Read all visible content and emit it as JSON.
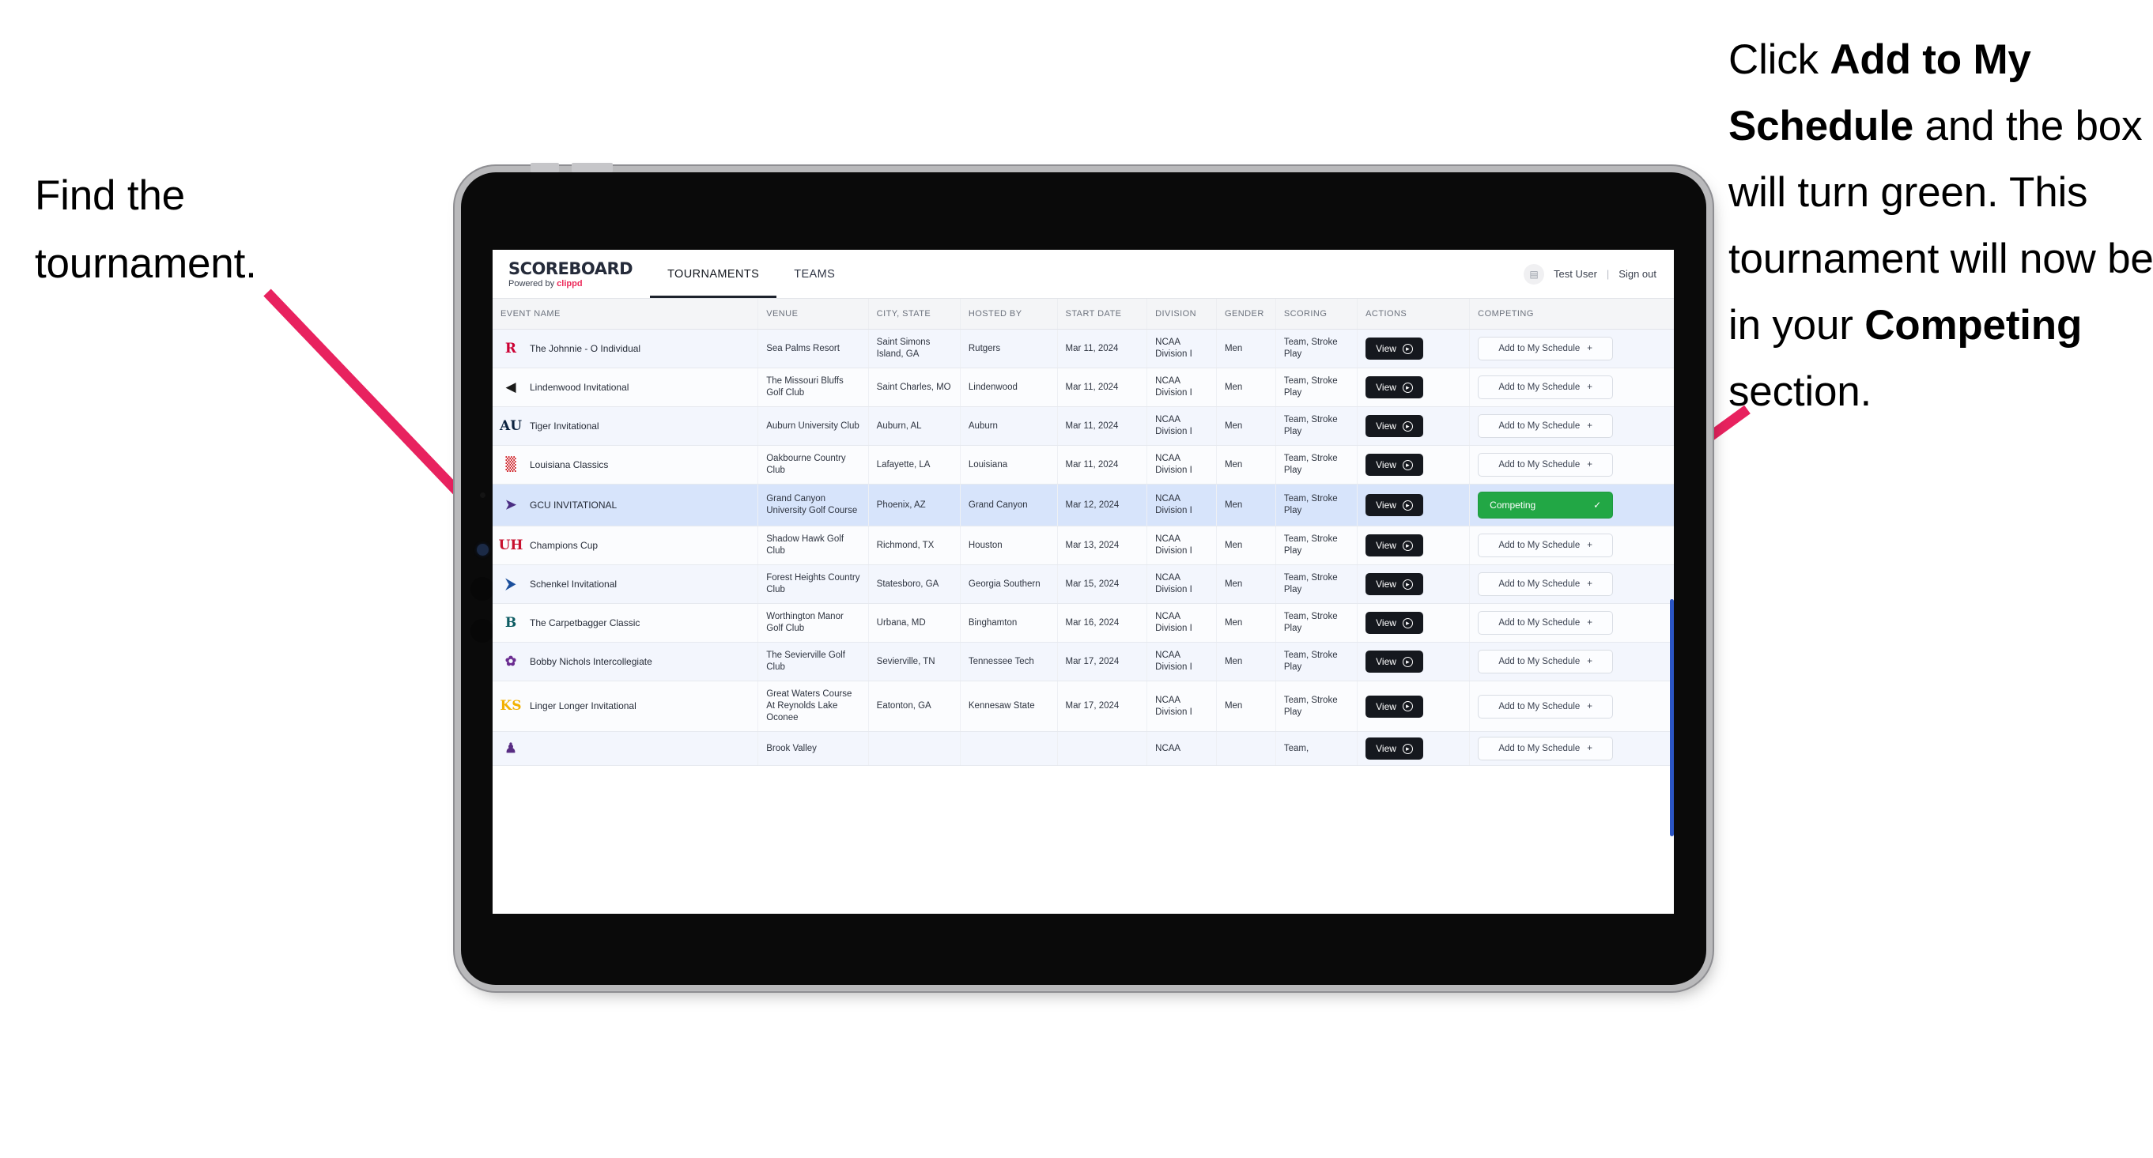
{
  "annotations": {
    "left": "Find the tournament.",
    "right_parts": [
      {
        "text": "Click ",
        "bold": false
      },
      {
        "text": "Add to My Schedule",
        "bold": true
      },
      {
        "text": " and the box will turn green. This tournament will now be in your ",
        "bold": false
      },
      {
        "text": "Competing",
        "bold": true
      },
      {
        "text": " section.",
        "bold": false
      }
    ],
    "arrow_color": "#e8225f"
  },
  "app": {
    "brand": {
      "title": "SCOREBOARD",
      "powered_prefix": "Powered by ",
      "powered_brand": "clippd",
      "brand_accent": "#ec2a5a"
    },
    "nav": [
      {
        "label": "TOURNAMENTS",
        "active": true
      },
      {
        "label": "TEAMS",
        "active": false
      }
    ],
    "account": {
      "avatar_icon": "user-avatar-icon",
      "user": "Test User",
      "separator": "|",
      "sign_out": "Sign out"
    },
    "table": {
      "columns": [
        "EVENT NAME",
        "VENUE",
        "CITY, STATE",
        "HOSTED BY",
        "START DATE",
        "DIVISION",
        "GENDER",
        "SCORING",
        "ACTIONS",
        "COMPETING"
      ],
      "action_label": "View",
      "add_label": "Add to My Schedule",
      "add_plus": "+",
      "competing_label": "Competing",
      "competing_check": "✓",
      "competing_color": "#22a745",
      "rows": [
        {
          "logo": {
            "text": "R",
            "color": "#cc0033",
            "bg": "transparent"
          },
          "event": "The Johnnie - O Individual",
          "venue": "Sea Palms Resort",
          "city": "Saint Simons Island, GA",
          "hosted_by": "Rutgers",
          "start_date": "Mar 11, 2024",
          "division": "NCAA Division I",
          "gender": "Men",
          "scoring": "Team, Stroke Play",
          "competing": false
        },
        {
          "logo": {
            "text": "◀",
            "color": "#1a1a1a",
            "bg": "transparent"
          },
          "event": "Lindenwood Invitational",
          "venue": "The Missouri Bluffs Golf Club",
          "city": "Saint Charles, MO",
          "hosted_by": "Lindenwood",
          "start_date": "Mar 11, 2024",
          "division": "NCAA Division I",
          "gender": "Men",
          "scoring": "Team, Stroke Play",
          "competing": false
        },
        {
          "logo": {
            "text": "AU",
            "color": "#0c2340",
            "bg": "transparent"
          },
          "event": "Tiger Invitational",
          "venue": "Auburn University Club",
          "city": "Auburn, AL",
          "hosted_by": "Auburn",
          "start_date": "Mar 11, 2024",
          "division": "NCAA Division I",
          "gender": "Men",
          "scoring": "Team, Stroke Play",
          "competing": false
        },
        {
          "logo": {
            "text": "▒",
            "color": "#ce181e",
            "bg": "transparent"
          },
          "event": "Louisiana Classics",
          "venue": "Oakbourne Country Club",
          "city": "Lafayette, LA",
          "hosted_by": "Louisiana",
          "start_date": "Mar 11, 2024",
          "division": "NCAA Division I",
          "gender": "Men",
          "scoring": "Team, Stroke Play",
          "competing": false
        },
        {
          "logo": {
            "text": "➤",
            "color": "#4b2e83",
            "bg": "transparent"
          },
          "event": "GCU INVITATIONAL",
          "venue": "Grand Canyon University Golf Course",
          "city": "Phoenix, AZ",
          "hosted_by": "Grand Canyon",
          "start_date": "Mar 12, 2024",
          "division": "NCAA Division I",
          "gender": "Men",
          "scoring": "Team, Stroke Play",
          "competing": true
        },
        {
          "logo": {
            "text": "UH",
            "color": "#c8102e",
            "bg": "transparent"
          },
          "event": "Champions Cup",
          "venue": "Shadow Hawk Golf Club",
          "city": "Richmond, TX",
          "hosted_by": "Houston",
          "start_date": "Mar 13, 2024",
          "division": "NCAA Division I",
          "gender": "Men",
          "scoring": "Team, Stroke Play",
          "competing": false
        },
        {
          "logo": {
            "text": "⮞",
            "color": "#1b4f9c",
            "bg": "transparent"
          },
          "event": "Schenkel Invitational",
          "venue": "Forest Heights Country Club",
          "city": "Statesboro, GA",
          "hosted_by": "Georgia Southern",
          "start_date": "Mar 15, 2024",
          "division": "NCAA Division I",
          "gender": "Men",
          "scoring": "Team, Stroke Play",
          "competing": false
        },
        {
          "logo": {
            "text": "B",
            "color": "#0d5c63",
            "bg": "transparent"
          },
          "event": "The Carpetbagger Classic",
          "venue": "Worthington Manor Golf Club",
          "city": "Urbana, MD",
          "hosted_by": "Binghamton",
          "start_date": "Mar 16, 2024",
          "division": "NCAA Division I",
          "gender": "Men",
          "scoring": "Team, Stroke Play",
          "competing": false
        },
        {
          "logo": {
            "text": "✿",
            "color": "#6b2c91",
            "bg": "transparent"
          },
          "event": "Bobby Nichols Intercollegiate",
          "venue": "The Sevierville Golf Club",
          "city": "Sevierville, TN",
          "hosted_by": "Tennessee Tech",
          "start_date": "Mar 17, 2024",
          "division": "NCAA Division I",
          "gender": "Men",
          "scoring": "Team, Stroke Play",
          "competing": false
        },
        {
          "logo": {
            "text": "KS",
            "color": "#f2b100",
            "bg": "transparent"
          },
          "event": "Linger Longer Invitational",
          "venue": "Great Waters Course At Reynolds Lake Oconee",
          "city": "Eatonton, GA",
          "hosted_by": "Kennesaw State",
          "start_date": "Mar 17, 2024",
          "division": "NCAA Division I",
          "gender": "Men",
          "scoring": "Team, Stroke Play",
          "competing": false
        },
        {
          "logo": {
            "text": "♟",
            "color": "#582c83",
            "bg": "transparent"
          },
          "event": "",
          "venue": "Brook Valley",
          "city": "",
          "hosted_by": "",
          "start_date": "",
          "division": "NCAA",
          "gender": "",
          "scoring": "Team,",
          "competing": false,
          "cut": true
        }
      ]
    }
  }
}
